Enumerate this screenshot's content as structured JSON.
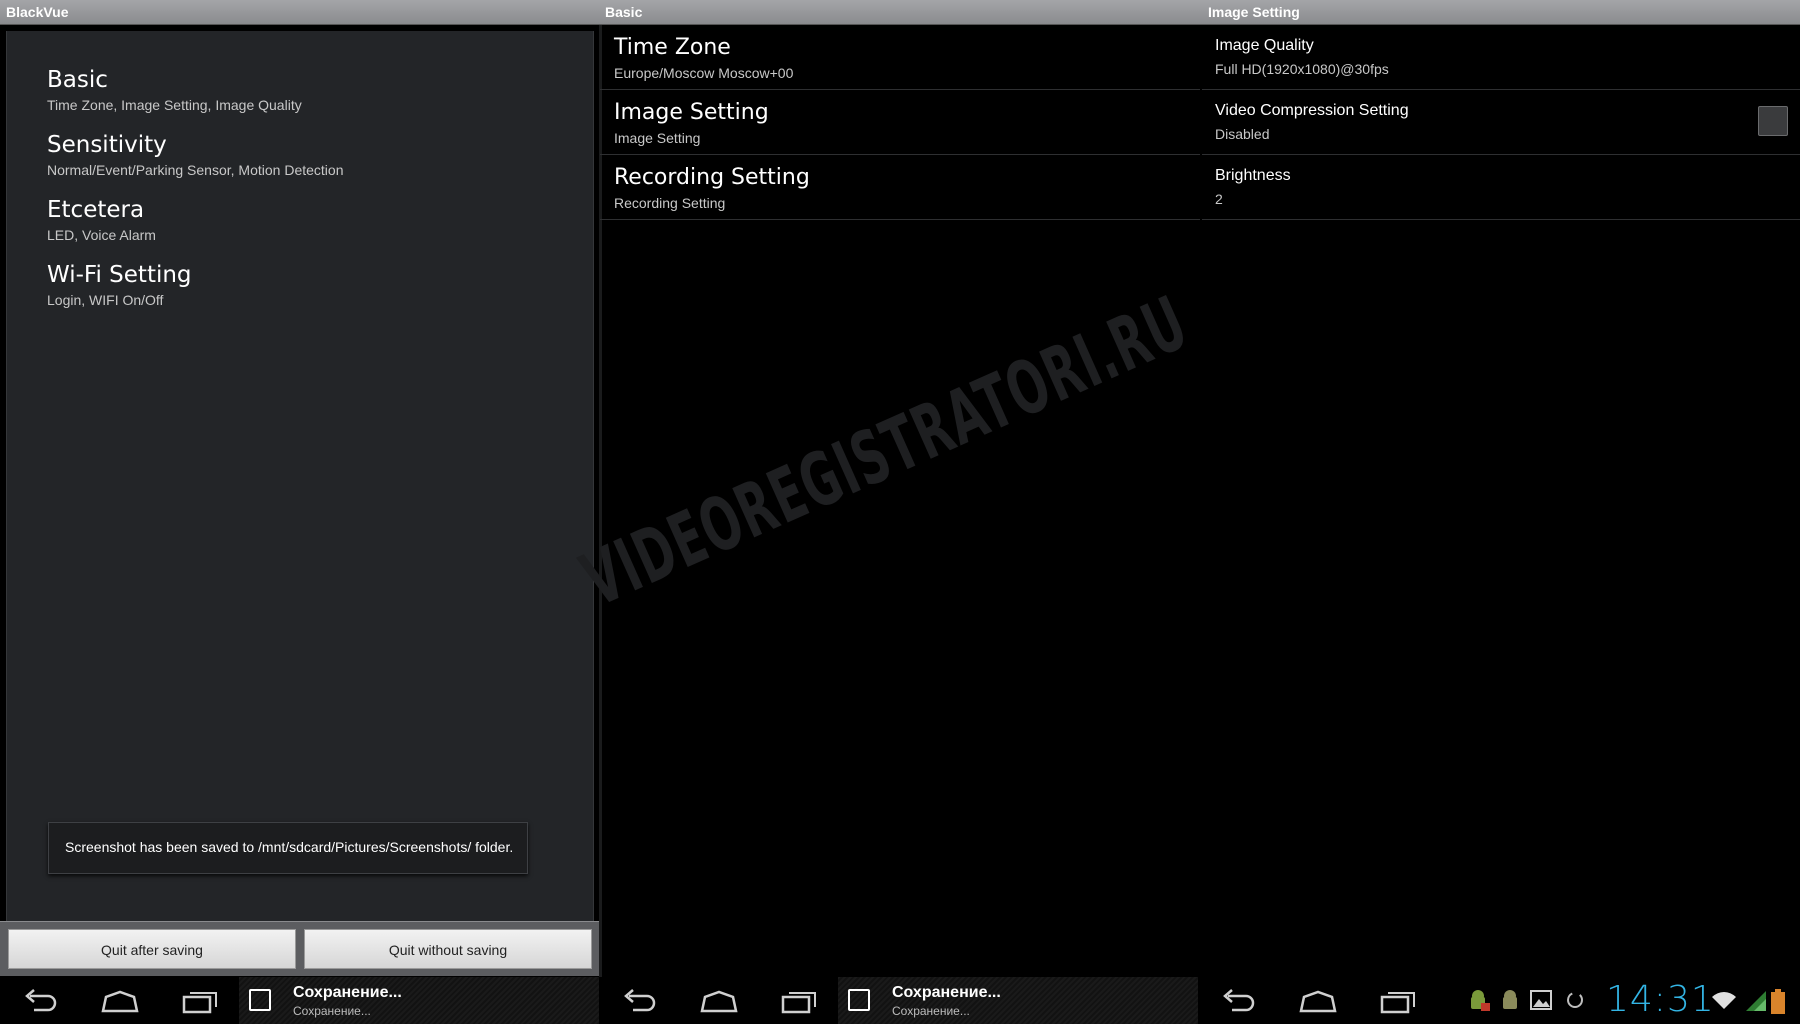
{
  "window_titles": [
    "BlackVue",
    "Basic",
    "Image Setting"
  ],
  "menu": [
    {
      "title": "Basic",
      "subtitle": "Time Zone, Image Setting, Image Quality"
    },
    {
      "title": "Sensitivity",
      "subtitle": "Normal/Event/Parking Sensor, Motion Detection"
    },
    {
      "title": "Etcetera",
      "subtitle": "LED, Voice Alarm"
    },
    {
      "title": "Wi-Fi Setting",
      "subtitle": "Login, WIFI On/Off"
    }
  ],
  "toast": "Screenshot has been saved to /mnt/sdcard/Pictures/Screenshots/ folder.",
  "buttons": {
    "quit_save": "Quit after saving",
    "quit_nosave": "Quit without saving"
  },
  "basic": [
    {
      "title": "Time Zone",
      "subtitle": "Europe/Moscow Moscow+00"
    },
    {
      "title": "Image Setting",
      "subtitle": "Image Setting"
    },
    {
      "title": "Recording Setting",
      "subtitle": "Recording Setting"
    }
  ],
  "image_setting": [
    {
      "title": "Image Quality",
      "subtitle": "Full HD(1920x1080)@30fps"
    },
    {
      "title": "Video Compression Setting",
      "subtitle": "Disabled",
      "checked": false
    },
    {
      "title": "Brightness",
      "subtitle": "2"
    }
  ],
  "watermark": "VIDEOREGISTRATORI.RU",
  "notification": {
    "title": "Сохранение...",
    "subtitle": "Сохранение..."
  },
  "status": {
    "clock": "14:31"
  },
  "icons": [
    "back-icon",
    "home-icon",
    "recent-apps-icon",
    "image-icon",
    "android-icon",
    "wifi-icon",
    "signal-icon",
    "battery-icon"
  ]
}
